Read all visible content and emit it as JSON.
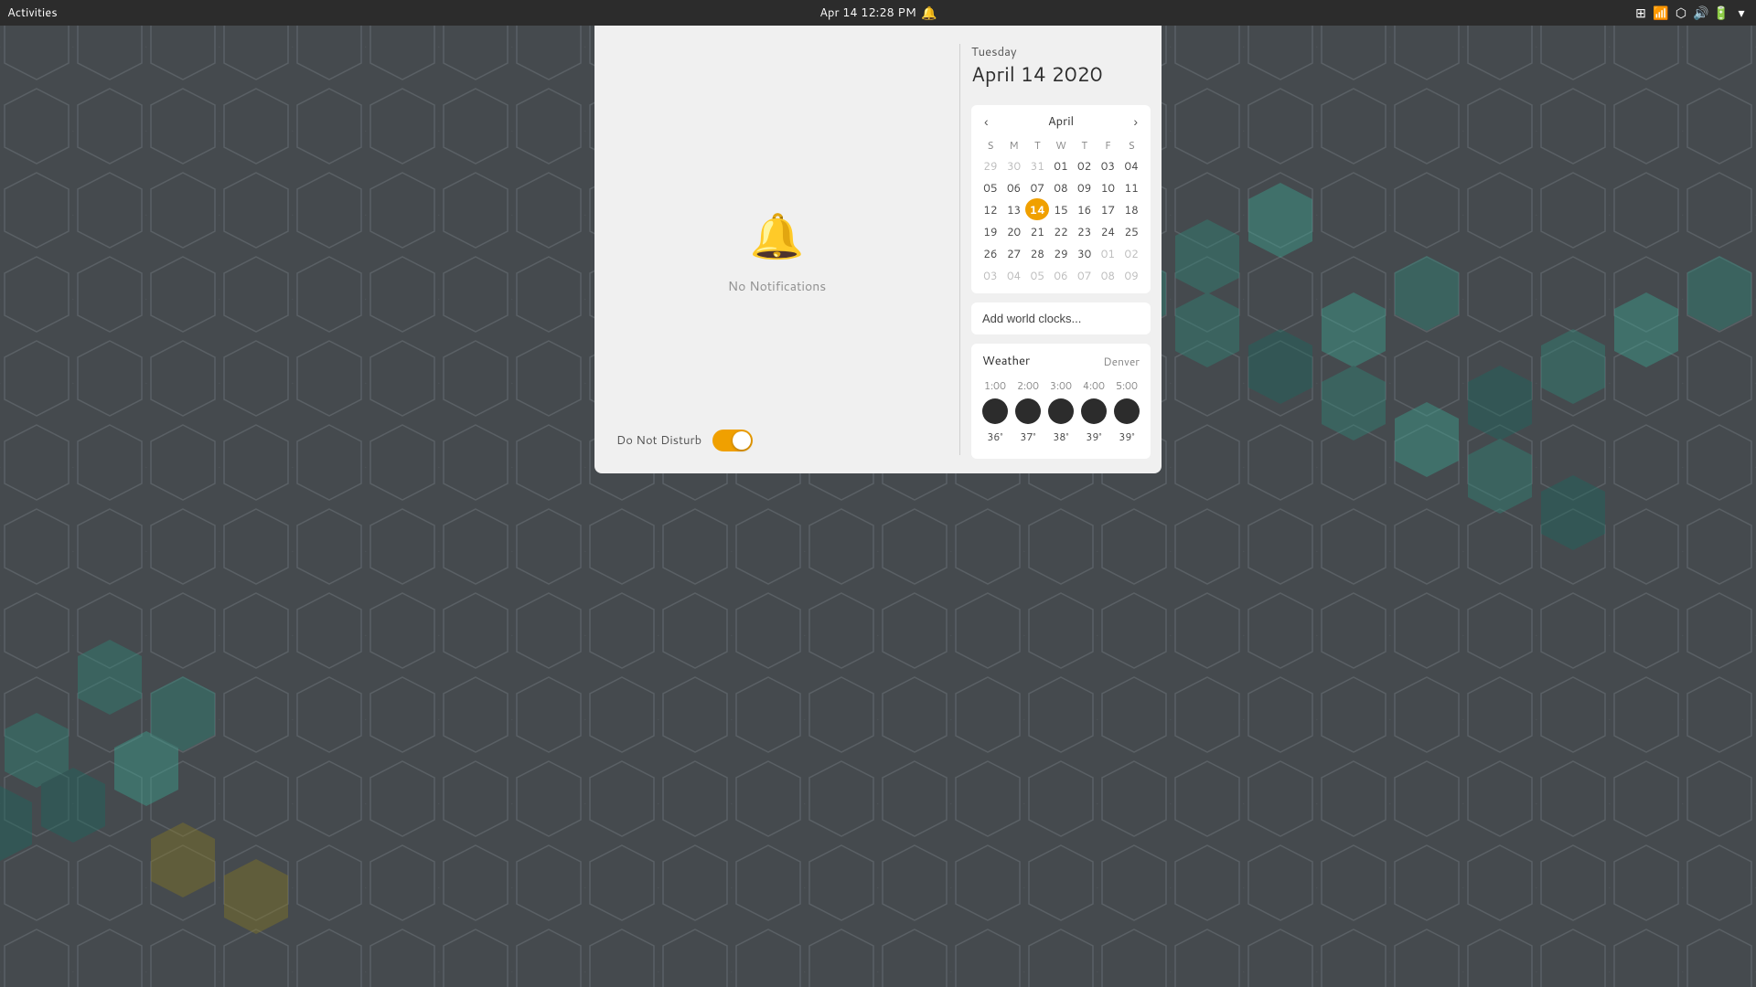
{
  "topbar": {
    "activities_label": "Activities",
    "datetime": "Apr 14  12:28 PM",
    "notification_muted": true
  },
  "popup": {
    "notification_panel": {
      "no_notifications_label": "No Notifications"
    },
    "dnd": {
      "label": "Do Not Disturb",
      "enabled": true
    },
    "calendar": {
      "month_label": "April",
      "nav_prev": "‹",
      "nav_next": "›",
      "day_headers": [
        "S",
        "M",
        "T",
        "W",
        "T",
        "F",
        "S"
      ],
      "weeks": [
        [
          "29",
          "30",
          "31",
          "01",
          "02",
          "03",
          "04"
        ],
        [
          "05",
          "06",
          "07",
          "08",
          "09",
          "10",
          "11"
        ],
        [
          "12",
          "13",
          "14",
          "15",
          "16",
          "17",
          "18"
        ],
        [
          "19",
          "20",
          "21",
          "22",
          "23",
          "24",
          "25"
        ],
        [
          "26",
          "27",
          "28",
          "29",
          "30",
          "01",
          "02"
        ],
        [
          "03",
          "04",
          "05",
          "06",
          "07",
          "08",
          "09"
        ]
      ],
      "today": "14",
      "today_row": 2,
      "today_col": 2,
      "other_month_prev": [
        "29",
        "30",
        "31"
      ],
      "other_month_next_row4": [
        "01",
        "02"
      ],
      "other_month_row5": [
        "03",
        "04",
        "05",
        "06",
        "07",
        "08",
        "09"
      ]
    },
    "add_clocks": {
      "label": "Add world clocks..."
    },
    "weather": {
      "title": "Weather",
      "location": "Denver",
      "times": [
        "1:00",
        "2:00",
        "3:00",
        "4:00",
        "5:00"
      ],
      "temps": [
        "36°",
        "37°",
        "38°",
        "39°",
        "39°"
      ]
    },
    "date_header": {
      "dayname": "Tuesday",
      "full_date": "April 14 2020"
    }
  }
}
